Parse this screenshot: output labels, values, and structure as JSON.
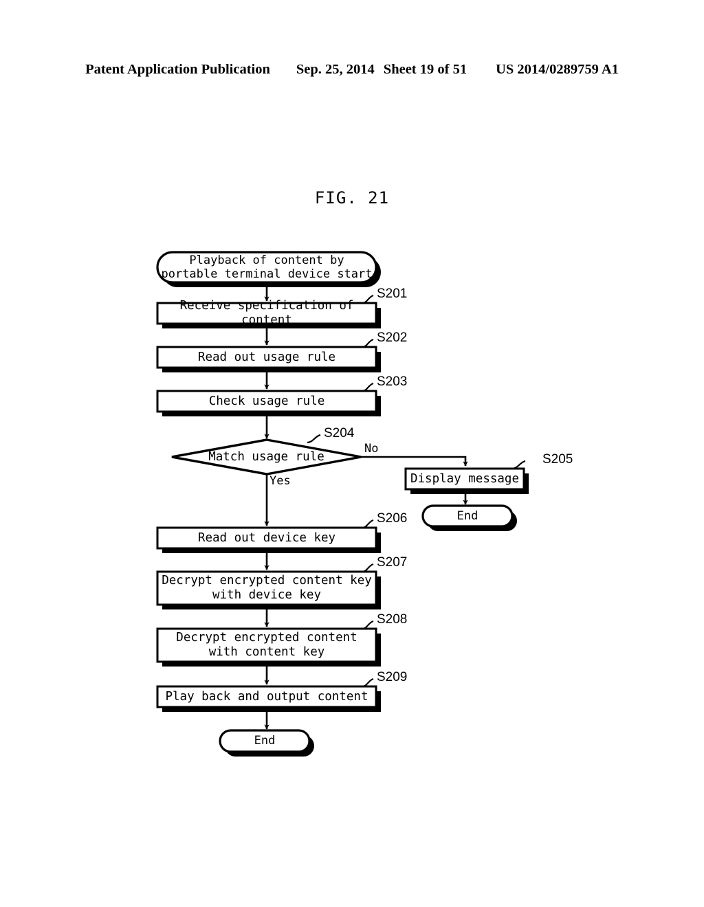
{
  "header": {
    "publication": "Patent Application Publication",
    "date": "Sep. 25, 2014",
    "sheet": "Sheet 19 of 51",
    "number": "US 2014/0289759 A1"
  },
  "figure": {
    "title": "FIG. 21"
  },
  "flowchart": {
    "start": {
      "label": "Playback of content by\nportable terminal device start",
      "shape": "terminator"
    },
    "steps": [
      {
        "tag": "S201",
        "label": "Receive specification of content",
        "shape": "process"
      },
      {
        "tag": "S202",
        "label": "Read out usage rule",
        "shape": "process"
      },
      {
        "tag": "S203",
        "label": "Check usage rule",
        "shape": "process"
      },
      {
        "tag": "S204",
        "label": "Match usage rule",
        "shape": "decision"
      },
      {
        "tag": "S205",
        "label": "Display message",
        "shape": "process"
      },
      {
        "tag": "S206",
        "label": "Read out device key",
        "shape": "process"
      },
      {
        "tag": "S207",
        "label": "Decrypt encrypted content key\nwith device key",
        "shape": "process"
      },
      {
        "tag": "S208",
        "label": "Decrypt encrypted content\nwith content key",
        "shape": "process"
      },
      {
        "tag": "S209",
        "label": "Play back and output content",
        "shape": "process"
      }
    ],
    "branches": {
      "no": "No",
      "yes": "Yes"
    },
    "ends": {
      "branch_end": "End",
      "main_end": "End"
    },
    "colors": {
      "stroke": "#000000",
      "fill": "#ffffff",
      "shadow": "#000000"
    }
  }
}
